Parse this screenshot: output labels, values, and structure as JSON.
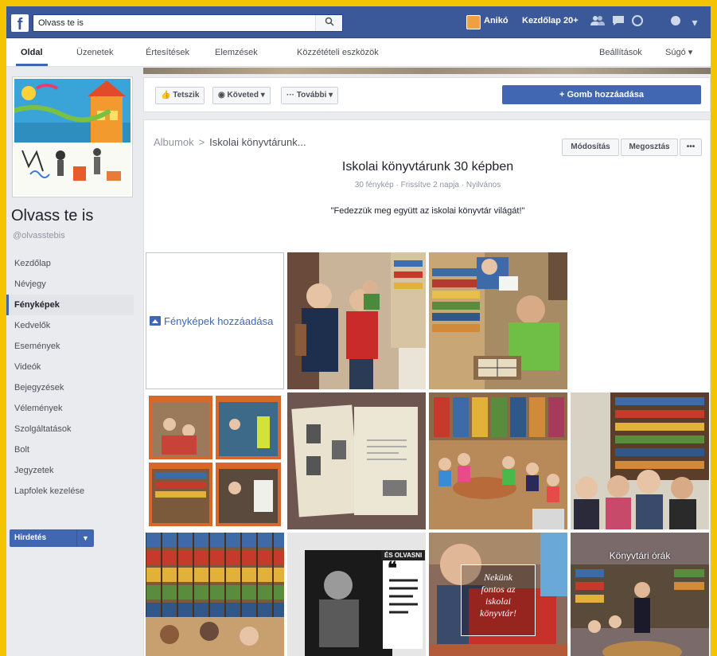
{
  "topbar": {
    "search_value": "Olvass te is",
    "user_name": "Anikó",
    "home_label": "Kezdőlap",
    "home_count": "20+"
  },
  "nav": {
    "tabs": [
      "Oldal",
      "Üzenetek",
      "Értesítések",
      "Elemzések",
      "Közzétételi eszközök"
    ],
    "settings": "Beállítások",
    "help": "Súgó ▾"
  },
  "page": {
    "name": "Olvass te is",
    "handle": "@olvasstebis"
  },
  "leftnav": {
    "items": [
      "Kezdőlap",
      "Névjegy",
      "Fényképek",
      "Kedvelők",
      "Események",
      "Videók",
      "Bejegyzések",
      "Vélemények",
      "Szolgáltatások",
      "Bolt",
      "Jegyzetek",
      "Lapfolek kezelése"
    ],
    "promote": "Hirdetés"
  },
  "actionbar": {
    "liked": "Tetszik",
    "follow": "Követed ▾",
    "more": "További ▾",
    "cta": "+ Gomb hozzáadása"
  },
  "album": {
    "breadcrumb_root": "Albumok",
    "breadcrumb_sep": ">",
    "breadcrumb_current": "Iskolai könyvtárunk...",
    "edit": "Módosítás",
    "share": "Megosztás",
    "more": "•••",
    "title": "Iskolai könyvtárunk 30 képben",
    "meta": "30 fénykép · Frissítve 2 napja · Nyilvános",
    "description": "\"Fedezzük meg együtt az iskolai könyvtár világát!\"",
    "add_photos": "Fényképek hozzáadása",
    "overlay_text": [
      "Nekünk",
      "fontos az",
      "iskolai",
      "könyvtár!"
    ],
    "caption_text": "Könyvtári órák",
    "banner_text": "ÉS OLVASNI"
  },
  "colors": {
    "frame": "#f5c400",
    "facebook_blue": "#3b5998",
    "button_blue": "#4267b2"
  }
}
